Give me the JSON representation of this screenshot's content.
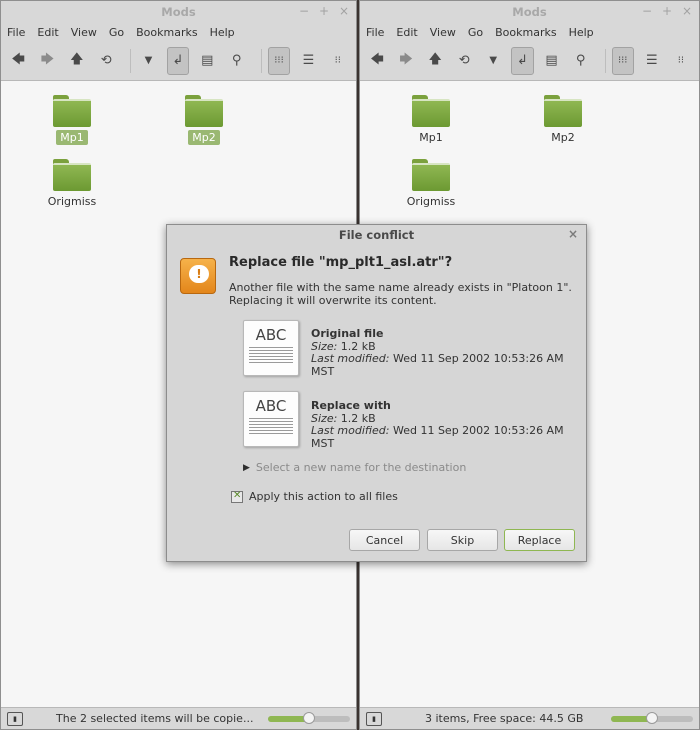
{
  "left_window": {
    "title": "Mods",
    "menu": [
      "File",
      "Edit",
      "View",
      "Go",
      "Bookmarks",
      "Help"
    ],
    "items": [
      {
        "name": "Mp1",
        "selected": true
      },
      {
        "name": "Mp2",
        "selected": true
      },
      {
        "name": "Origmiss",
        "selected": false
      }
    ],
    "status": "The 2 selected items will be copie...",
    "zoom_fraction": 0.5
  },
  "right_window": {
    "title": "Mods",
    "menu": [
      "File",
      "Edit",
      "View",
      "Go",
      "Bookmarks",
      "Help"
    ],
    "items": [
      {
        "name": "Mp1",
        "selected": false
      },
      {
        "name": "Mp2",
        "selected": false
      },
      {
        "name": "Origmiss",
        "selected": false
      }
    ],
    "status": "3 items, Free space: 44.5 GB",
    "zoom_fraction": 0.5
  },
  "window_controls": {
    "minimize": "−",
    "maximize": "+",
    "close": "×"
  },
  "icons": {
    "back": "back-arrow-icon",
    "forward": "forward-arrow-icon",
    "up": "up-arrow-icon",
    "reload": "reload-icon",
    "toggle_location": "location-toggle-icon",
    "new_folder": "new-folder-icon",
    "search": "search-icon",
    "icon_view": "icon-view-icon",
    "list_view": "list-view-icon",
    "compact_view": "compact-view-icon"
  },
  "colors": {
    "selection": "#9ab872",
    "accent": "#8fb752",
    "warning": "#e3861b"
  },
  "dialog": {
    "title": "File conflict",
    "close": "×",
    "heading": "Replace file \"mp_plt1_asl.atr\"?",
    "subtext_line1": "Another file with the same name already exists in \"Platoon 1\".",
    "subtext_line2": "Replacing it will overwrite its content.",
    "thumb_text": "ABC",
    "original": {
      "heading": "Original file",
      "size_label": "Size:",
      "size": "1.2 kB",
      "modified_label": "Last modified:",
      "modified": "Wed 11 Sep 2002 10:53:26 AM MST"
    },
    "replacement": {
      "heading": "Replace with",
      "size_label": "Size:",
      "size": "1.2 kB",
      "modified_label": "Last modified:",
      "modified": "Wed 11 Sep 2002 10:53:26 AM MST"
    },
    "expander_label": "Select a new name for the destination",
    "apply_all_label": "Apply this action to all files",
    "apply_all_checked": true,
    "buttons": {
      "cancel": "Cancel",
      "skip": "Skip",
      "replace": "Replace"
    }
  }
}
